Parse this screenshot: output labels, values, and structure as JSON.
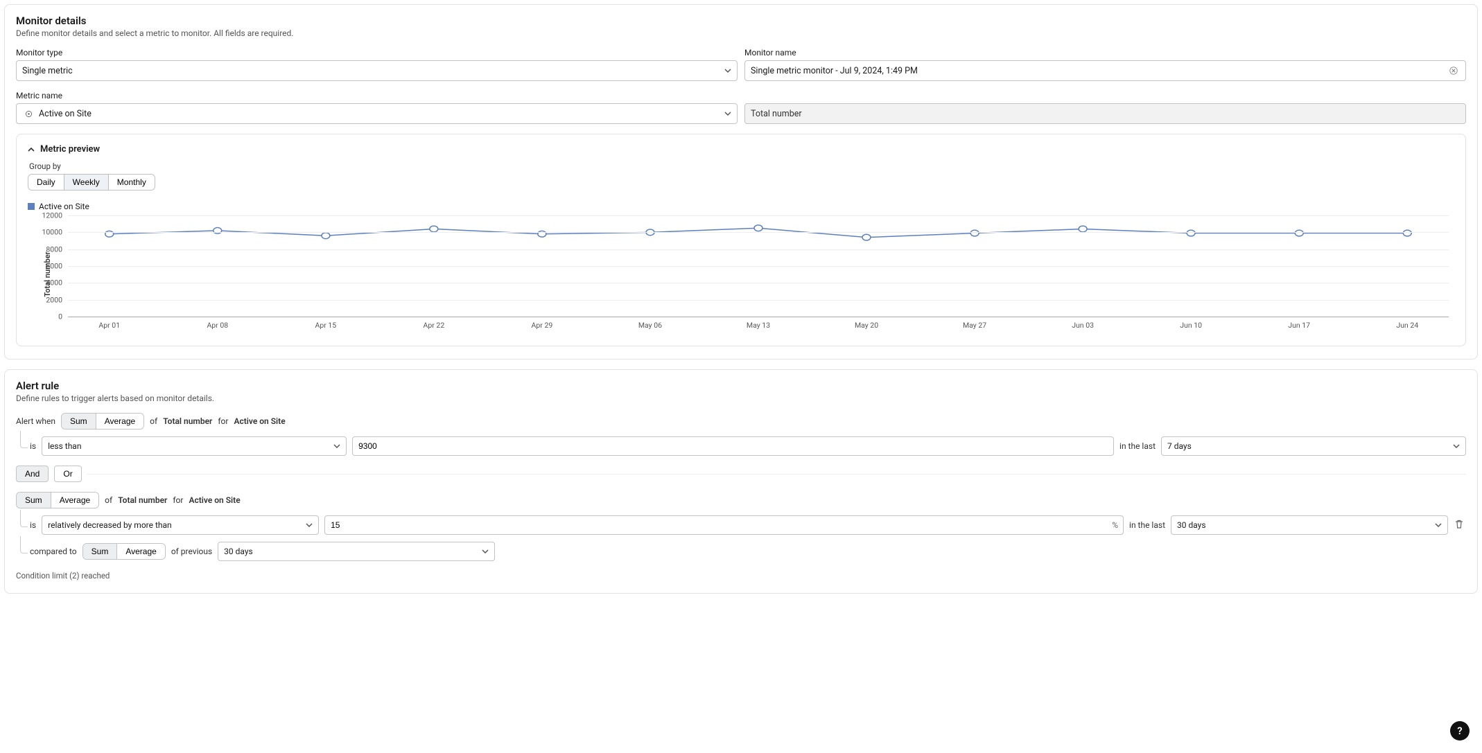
{
  "monitorDetails": {
    "title": "Monitor details",
    "subtitle": "Define monitor details and select a metric to monitor. All fields are required.",
    "monitorTypeLabel": "Monitor type",
    "monitorTypeValue": "Single metric",
    "monitorNameLabel": "Monitor name",
    "monitorNameValue": "Single metric monitor - Jul 9, 2024, 1:49 PM",
    "metricNameLabel": "Metric name",
    "metricNameValue": "Active on Site",
    "metricAggValue": "Total number"
  },
  "metricPreview": {
    "header": "Metric preview",
    "groupByLabel": "Group by",
    "options": [
      "Daily",
      "Weekly",
      "Monthly"
    ],
    "selected": "Weekly",
    "legendSeries": "Active on Site"
  },
  "chart_data": {
    "type": "line",
    "title": "",
    "ylabel": "Total number",
    "xlabel": "",
    "ylim": [
      0,
      12000
    ],
    "yticks": [
      0,
      2000,
      4000,
      6000,
      8000,
      10000,
      12000
    ],
    "categories": [
      "Apr 01",
      "Apr 08",
      "Apr 15",
      "Apr 22",
      "Apr 29",
      "May 06",
      "May 13",
      "May 20",
      "May 27",
      "Jun 03",
      "Jun 10",
      "Jun 17",
      "Jun 24"
    ],
    "series": [
      {
        "name": "Active on Site",
        "values": [
          9800,
          10200,
          9600,
          10400,
          9800,
          10000,
          10500,
          9400,
          9900,
          10400,
          9900,
          9900,
          9900
        ]
      }
    ]
  },
  "alertRule": {
    "title": "Alert rule",
    "subtitle": "Define rules to trigger alerts based on monitor details.",
    "alertWhen": "Alert when",
    "of": "of",
    "forTxt": "for",
    "metricAgg": "Total number",
    "metricName": "Active on Site",
    "cond1": {
      "aggOptions": [
        "Sum",
        "Average"
      ],
      "aggSelected": "Sum",
      "isLabel": "is",
      "comparator": "less than",
      "threshold": "9300",
      "inLast": "in the last",
      "window": "7 days"
    },
    "conj": {
      "options": [
        "And",
        "Or"
      ],
      "selected": "And"
    },
    "cond2": {
      "aggOptions": [
        "Sum",
        "Average"
      ],
      "aggSelected": "Sum",
      "isLabel": "is",
      "comparator": "relatively decreased by more than",
      "pct": "15",
      "pctSuffix": "%",
      "inLast": "in the last",
      "window": "30 days",
      "comparedTo": "compared to",
      "comparedAggOptions": [
        "Sum",
        "Average"
      ],
      "comparedAggSelected": "Sum",
      "ofPrev": "of previous",
      "prevWindow": "30 days"
    },
    "limitText": "Condition limit (2) reached"
  },
  "helpGlyph": "?"
}
